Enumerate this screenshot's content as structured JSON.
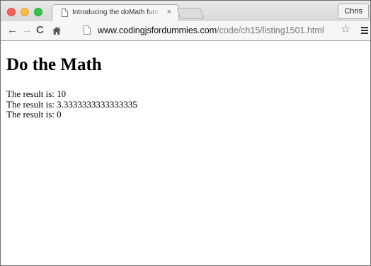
{
  "browser": {
    "tab_title": "Introducing the doMath function",
    "tab_close": "×",
    "profile_name": "Chris",
    "url": {
      "domain": "www.codingjsfordummies.com",
      "path": "/code/ch15/listing1501.html"
    },
    "nav": {
      "back_icon": "←",
      "forward_icon": "→",
      "reload_icon": "C",
      "star_icon": "☆"
    }
  },
  "page": {
    "heading": "Do the Math",
    "results": [
      "The result is: 10",
      "The result is: 3.3333333333333335",
      "The result is: 0"
    ]
  }
}
